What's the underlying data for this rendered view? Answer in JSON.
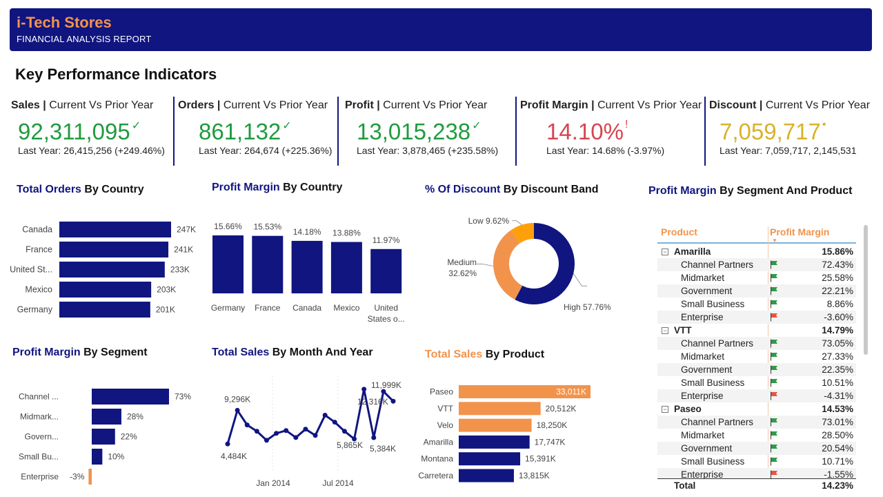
{
  "header": {
    "brand": "i-Tech Stores",
    "subtitle": "FINANCIAL ANALYSIS REPORT"
  },
  "kpi_heading": "Key Performance Indicators",
  "colors": {
    "navy": "#10157f",
    "orange": "#f2934c",
    "green": "#1e9b3e",
    "red": "#d64550",
    "gold": "#d7b22a",
    "flag_green": "#2e9b46",
    "flag_red": "#e8553e"
  },
  "kpis": [
    {
      "metric": "Sales",
      "suffix": "Current Vs Prior Year",
      "value": "92,311,095",
      "mark": "✓",
      "last": "Last Year: 26,415,256 (+249.46%)"
    },
    {
      "metric": "Orders",
      "suffix": "Current Vs Prior Year",
      "value": "861,132",
      "mark": "✓",
      "last": "Last Year: 264,674 (+225.36%)"
    },
    {
      "metric": "Profit",
      "suffix": "Current Vs Prior Year",
      "value": "13,015,238",
      "mark": "✓",
      "last": "Last Year: 3,878,465 (+235.58%)"
    },
    {
      "metric": "Profit Margin",
      "suffix": "Current Vs Prior Year",
      "value": "14.10%",
      "mark": "!",
      "last": "Last Year: 14.68% (-3.97%)"
    },
    {
      "metric": "Discount",
      "suffix": "Current Vs Prior Year",
      "value": "7,059,717",
      "mark": "•",
      "last": "Last Year: 7,059,717, 2,145,531"
    }
  ],
  "titles": {
    "orders_country": {
      "hl": "Total Orders",
      "rest": " By Country"
    },
    "margin_country": {
      "hl": "Profit Margin",
      "rest": " By Country"
    },
    "discount_band": {
      "hl": "% Of Discount",
      "rest": " By Discount Band"
    },
    "margin_segment_product": {
      "hl": "Profit Margin",
      "rest": " By Segment And Product"
    },
    "margin_segment": {
      "hl": "Profit Margin",
      "rest": " By Segment"
    },
    "sales_month": {
      "hl": "Total Sales",
      "rest": " By Month And Year"
    },
    "sales_product": {
      "hl": "Total Sales",
      "rest": " By Product"
    }
  },
  "chart_data": [
    {
      "id": "orders_by_country",
      "type": "bar",
      "orientation": "horizontal",
      "categories": [
        "Canada",
        "France",
        "United St...",
        "Mexico",
        "Germany"
      ],
      "values": [
        247,
        241,
        233,
        203,
        201
      ],
      "labels": [
        "247K",
        "241K",
        "233K",
        "203K",
        "201K"
      ]
    },
    {
      "id": "margin_by_country",
      "type": "bar",
      "orientation": "vertical",
      "categories": [
        "Germany",
        "France",
        "Canada",
        "Mexico",
        "United States o..."
      ],
      "values": [
        15.66,
        15.53,
        14.18,
        13.88,
        11.97
      ],
      "labels": [
        "15.66%",
        "15.53%",
        "14.18%",
        "13.88%",
        "11.97%"
      ]
    },
    {
      "id": "discount_by_band",
      "type": "pie",
      "donut": true,
      "slices": [
        {
          "name": "High",
          "value": 57.76,
          "label": "High 57.76%",
          "color": "#10157f"
        },
        {
          "name": "Medium",
          "value": 32.62,
          "label1": "Medium",
          "label2": "32.62%",
          "color": "#f2934c"
        },
        {
          "name": "Low",
          "value": 9.62,
          "label": "Low 9.62%",
          "color": "#ff9f0a"
        }
      ]
    },
    {
      "id": "margin_by_segment",
      "type": "bar",
      "orientation": "horizontal",
      "categories": [
        "Channel ...",
        "Midmark...",
        "Govern...",
        "Small Bu...",
        "Enterprise"
      ],
      "values": [
        73,
        28,
        22,
        10,
        -3
      ],
      "labels": [
        "73%",
        "28%",
        "22%",
        "10%",
        "-3%"
      ]
    },
    {
      "id": "sales_by_month",
      "type": "line",
      "values": [
        4484,
        9296,
        7200,
        6300,
        5000,
        6000,
        6400,
        5400,
        6600,
        5700,
        8600,
        7600,
        6300,
        5200,
        12316,
        5384,
        11999,
        10600
      ],
      "point_labels": [
        {
          "index": 0,
          "text": "4,484K"
        },
        {
          "index": 1,
          "text": "9,296K"
        },
        {
          "index": 13,
          "text": "5,865K"
        },
        {
          "index": 14,
          "text": "12,316K"
        },
        {
          "index": 15,
          "text": "5,384K"
        },
        {
          "index": 16,
          "text": "11,999K"
        }
      ],
      "x_ticks": [
        "Jan 2014",
        "Jul 2014"
      ]
    },
    {
      "id": "sales_by_product",
      "type": "bar",
      "orientation": "horizontal",
      "categories": [
        "Paseo",
        "VTT",
        "Velo",
        "Amarilla",
        "Montana",
        "Carretera"
      ],
      "values": [
        33011,
        20512,
        18250,
        17747,
        15391,
        13815
      ],
      "labels": [
        "33,011K",
        "20,512K",
        "18,250K",
        "17,747K",
        "15,391K",
        "13,815K"
      ],
      "colors": [
        "#f2934c",
        "#f2934c",
        "#f2934c",
        "#10157f",
        "#10157f",
        "#10157f"
      ]
    }
  ],
  "matrix": {
    "headers": {
      "product": "Product",
      "margin": "Profit Margin"
    },
    "rows": [
      {
        "label": "Amarilla",
        "value": "15.86%",
        "group": true
      },
      {
        "label": "Channel Partners",
        "value": "72.43%",
        "flag": "green"
      },
      {
        "label": "Midmarket",
        "value": "25.58%",
        "flag": "green"
      },
      {
        "label": "Government",
        "value": "22.21%",
        "flag": "green"
      },
      {
        "label": "Small Business",
        "value": "8.86%",
        "flag": "green"
      },
      {
        "label": "Enterprise",
        "value": "-3.60%",
        "flag": "red"
      },
      {
        "label": "VTT",
        "value": "14.79%",
        "group": true
      },
      {
        "label": "Channel Partners",
        "value": "73.05%",
        "flag": "green"
      },
      {
        "label": "Midmarket",
        "value": "27.33%",
        "flag": "green"
      },
      {
        "label": "Government",
        "value": "22.35%",
        "flag": "green"
      },
      {
        "label": "Small Business",
        "value": "10.51%",
        "flag": "green"
      },
      {
        "label": "Enterprise",
        "value": "-4.31%",
        "flag": "red"
      },
      {
        "label": "Paseo",
        "value": "14.53%",
        "group": true
      },
      {
        "label": "Channel Partners",
        "value": "73.01%",
        "flag": "green"
      },
      {
        "label": "Midmarket",
        "value": "28.50%",
        "flag": "green"
      },
      {
        "label": "Government",
        "value": "20.54%",
        "flag": "green"
      },
      {
        "label": "Small Business",
        "value": "10.71%",
        "flag": "green"
      },
      {
        "label": "Enterprise",
        "value": "-1.55%",
        "flag": "red"
      }
    ],
    "total": {
      "label": "Total",
      "value": "14.23%"
    }
  }
}
